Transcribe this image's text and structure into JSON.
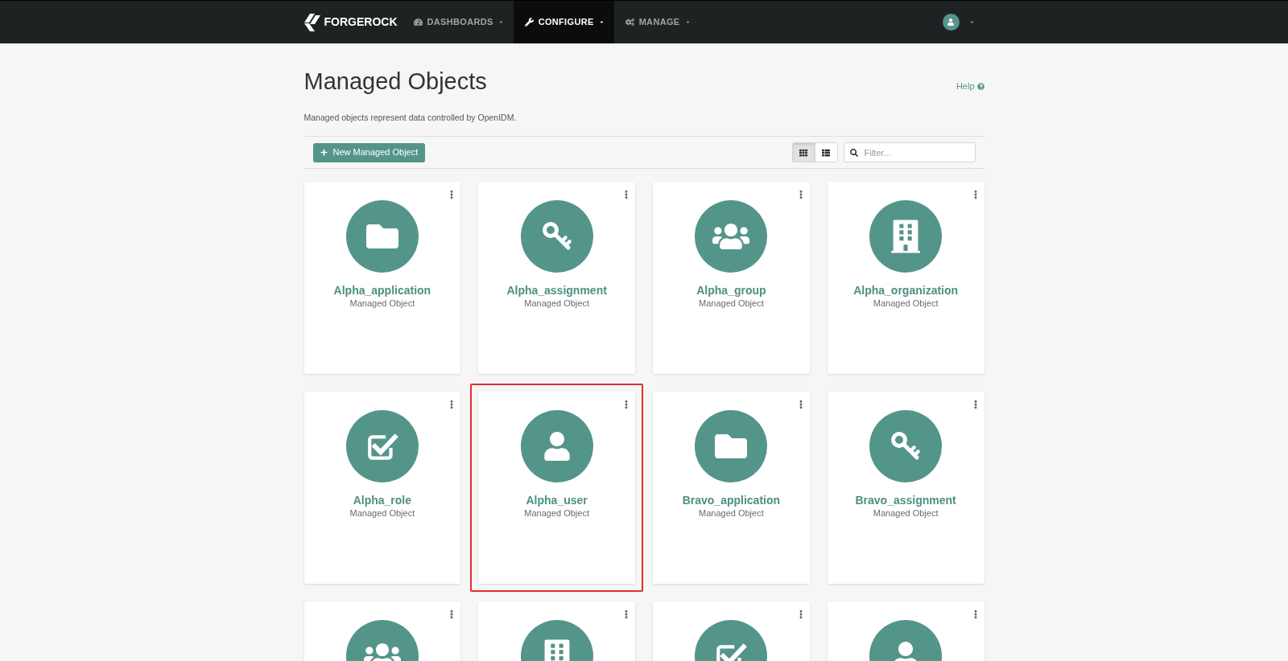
{
  "nav": {
    "logo": "FORGEROCK",
    "items": [
      {
        "label": "DASHBOARDS",
        "kind": "dashboard",
        "selected": false
      },
      {
        "label": "CONFIGURE",
        "kind": "wrench",
        "selected": true
      },
      {
        "label": "MANAGE",
        "kind": "cogs",
        "selected": false
      }
    ]
  },
  "page": {
    "title": "Managed Objects",
    "help": "Help",
    "description": "Managed objects represent data controlled by OpenIDM."
  },
  "toolbar": {
    "new_button": "New Managed Object",
    "view_toggles": [
      {
        "kind": "grid",
        "selected": true
      },
      {
        "kind": "list",
        "selected": false
      }
    ],
    "filter": {
      "placeholder": "Filter..."
    }
  },
  "cards": [
    {
      "name": "Alpha_application",
      "type": "Managed Object",
      "kind": "folder",
      "highlighted": false
    },
    {
      "name": "Alpha_assignment",
      "type": "Managed Object",
      "kind": "key",
      "highlighted": false
    },
    {
      "name": "Alpha_group",
      "type": "Managed Object",
      "kind": "group",
      "highlighted": false
    },
    {
      "name": "Alpha_organization",
      "type": "Managed Object",
      "kind": "building",
      "highlighted": false
    },
    {
      "name": "Alpha_role",
      "type": "Managed Object",
      "kind": "checkbox",
      "highlighted": false
    },
    {
      "name": "Alpha_user",
      "type": "Managed Object",
      "kind": "user",
      "highlighted": true
    },
    {
      "name": "Bravo_application",
      "type": "Managed Object",
      "kind": "folder",
      "highlighted": false
    },
    {
      "name": "Bravo_assignment",
      "type": "Managed Object",
      "kind": "key",
      "highlighted": false
    },
    {
      "kind": "group",
      "highlighted": false
    },
    {
      "kind": "building",
      "highlighted": false
    },
    {
      "kind": "checkbox",
      "highlighted": false
    },
    {
      "kind": "user",
      "highlighted": false
    }
  ]
}
